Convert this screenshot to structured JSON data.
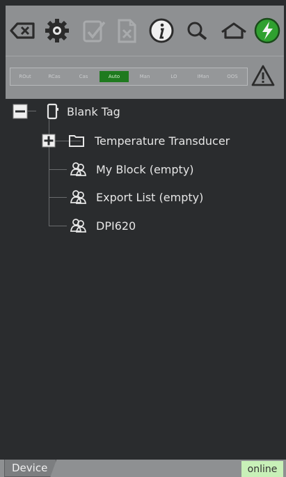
{
  "toolbar": {
    "icons": [
      "backspace-icon",
      "gear-icon",
      "checklist-icon",
      "delete-doc-icon",
      "info-icon",
      "search-icon",
      "home-icon",
      "connect-icon"
    ]
  },
  "modes": [
    "ROut",
    "RCas",
    "Cas",
    "Auto",
    "Man",
    "LO",
    "IMan",
    "OOS"
  ],
  "active_mode": "Auto",
  "tree": {
    "root": "Blank Tag",
    "children": [
      {
        "label": "Temperature Transducer"
      },
      {
        "label": "My Block (empty)"
      },
      {
        "label": "Export List (empty)"
      },
      {
        "label": "DPI620"
      }
    ]
  },
  "footer": {
    "tab": "Device",
    "status": "online"
  },
  "colors": {
    "toolbar_bg": "#8e9092",
    "tree_bg": "#2a2c2e",
    "active_mode": "#1f7a1f",
    "online_bg": "#c8f0b8",
    "connect_green": "#2fa02f"
  }
}
